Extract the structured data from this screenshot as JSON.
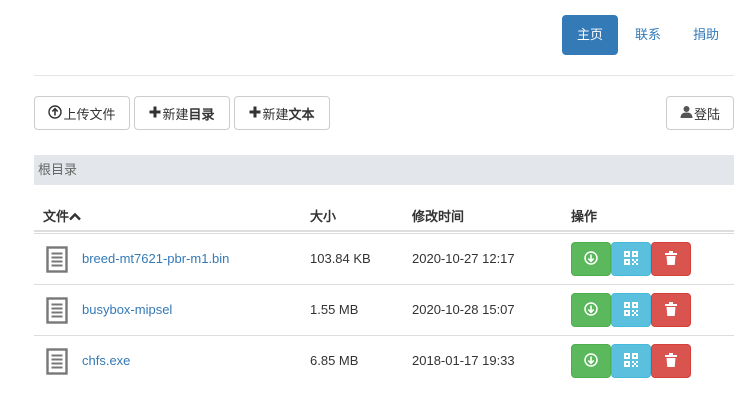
{
  "nav": {
    "home": "主页",
    "contact": "联系",
    "donate": "捐助"
  },
  "toolbar": {
    "upload_label": "上传文件",
    "new_dir_prefix": "新建",
    "new_dir_bold": "目录",
    "new_text_prefix": "新建",
    "new_text_bold": "文本",
    "login_label": "登陆"
  },
  "breadcrumb": "根目录",
  "table": {
    "headers": {
      "name": "文件",
      "size": "大小",
      "mtime": "修改时间",
      "actions": "操作"
    },
    "sort_icon": "chevron-up-icon",
    "rows": [
      {
        "name": "breed-mt7621-pbr-m1.bin",
        "size": "103.84 KB",
        "mtime": "2020-10-27 12:17"
      },
      {
        "name": "busybox-mipsel",
        "size": "1.55 MB",
        "mtime": "2020-10-28 15:07"
      },
      {
        "name": "chfs.exe",
        "size": "6.85 MB",
        "mtime": "2018-01-17 19:33"
      }
    ]
  },
  "colors": {
    "primary": "#337ab7",
    "success": "#5cb85c",
    "info": "#5bc0de",
    "danger": "#d9534f"
  }
}
